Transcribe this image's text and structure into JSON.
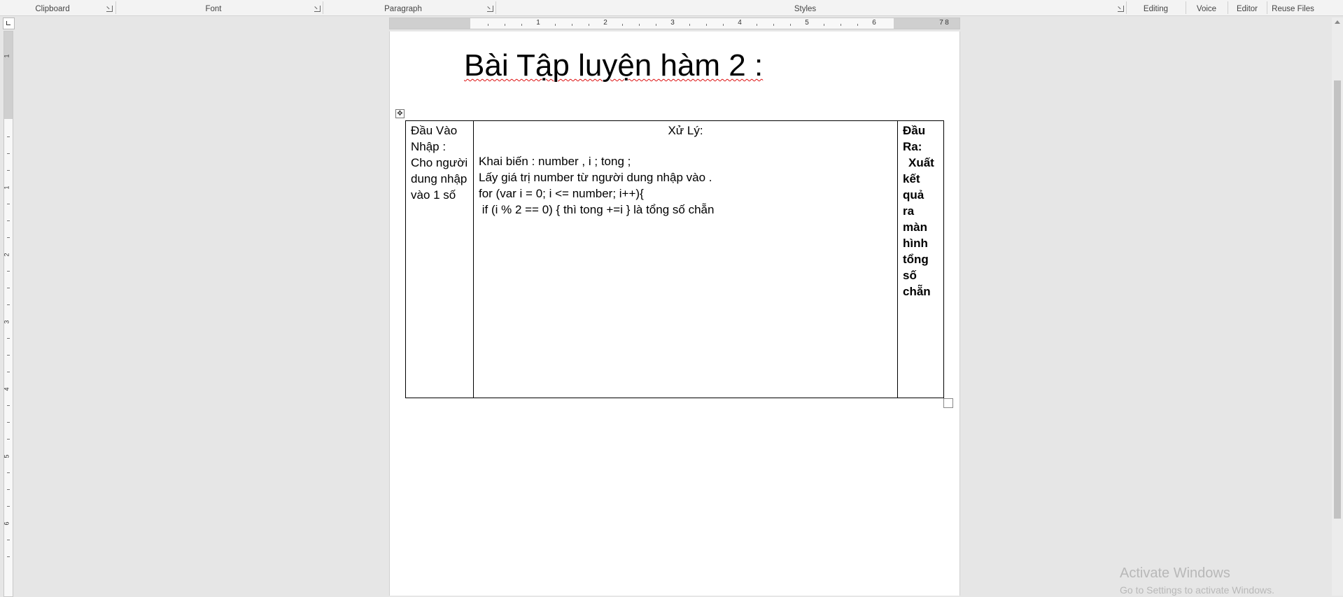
{
  "ribbon": {
    "groups": [
      "Clipboard",
      "Font",
      "Paragraph",
      "Styles",
      "Editing",
      "Voice",
      "Editor",
      "Reuse Files"
    ]
  },
  "ruler": {
    "horizontal_numbers": [
      "1",
      "2",
      "3",
      "4",
      "5",
      "6",
      "7",
      "8"
    ],
    "vertical_numbers": [
      "1",
      "1",
      "2",
      "3",
      "4",
      "5",
      "6"
    ]
  },
  "document": {
    "title": "Bài Tập luyện hàm 2 :",
    "table": {
      "input_header": "Đầu Vào",
      "input_lines": [
        "Nhập :",
        "Cho người",
        "dung nhập",
        "vào 1 số"
      ],
      "process_header": "Xử Lý:",
      "process_lines": [
        "Khai biến : number , i ; tong ;",
        "Lấy giá trị number từ người dung nhập vào .",
        "for (var i = 0; i <= number; i++){",
        " if (i % 2 == 0) { thì tong +=i } là tổng số chẵn"
      ],
      "output_lines": [
        "Đầu",
        "Ra:",
        "Xuất",
        "kết",
        "quả ra",
        "màn",
        "hình",
        "tổng",
        "số",
        "chẵn"
      ]
    }
  },
  "watermark": {
    "line1": "Activate Windows",
    "line2": "Go to Settings to activate Windows."
  }
}
